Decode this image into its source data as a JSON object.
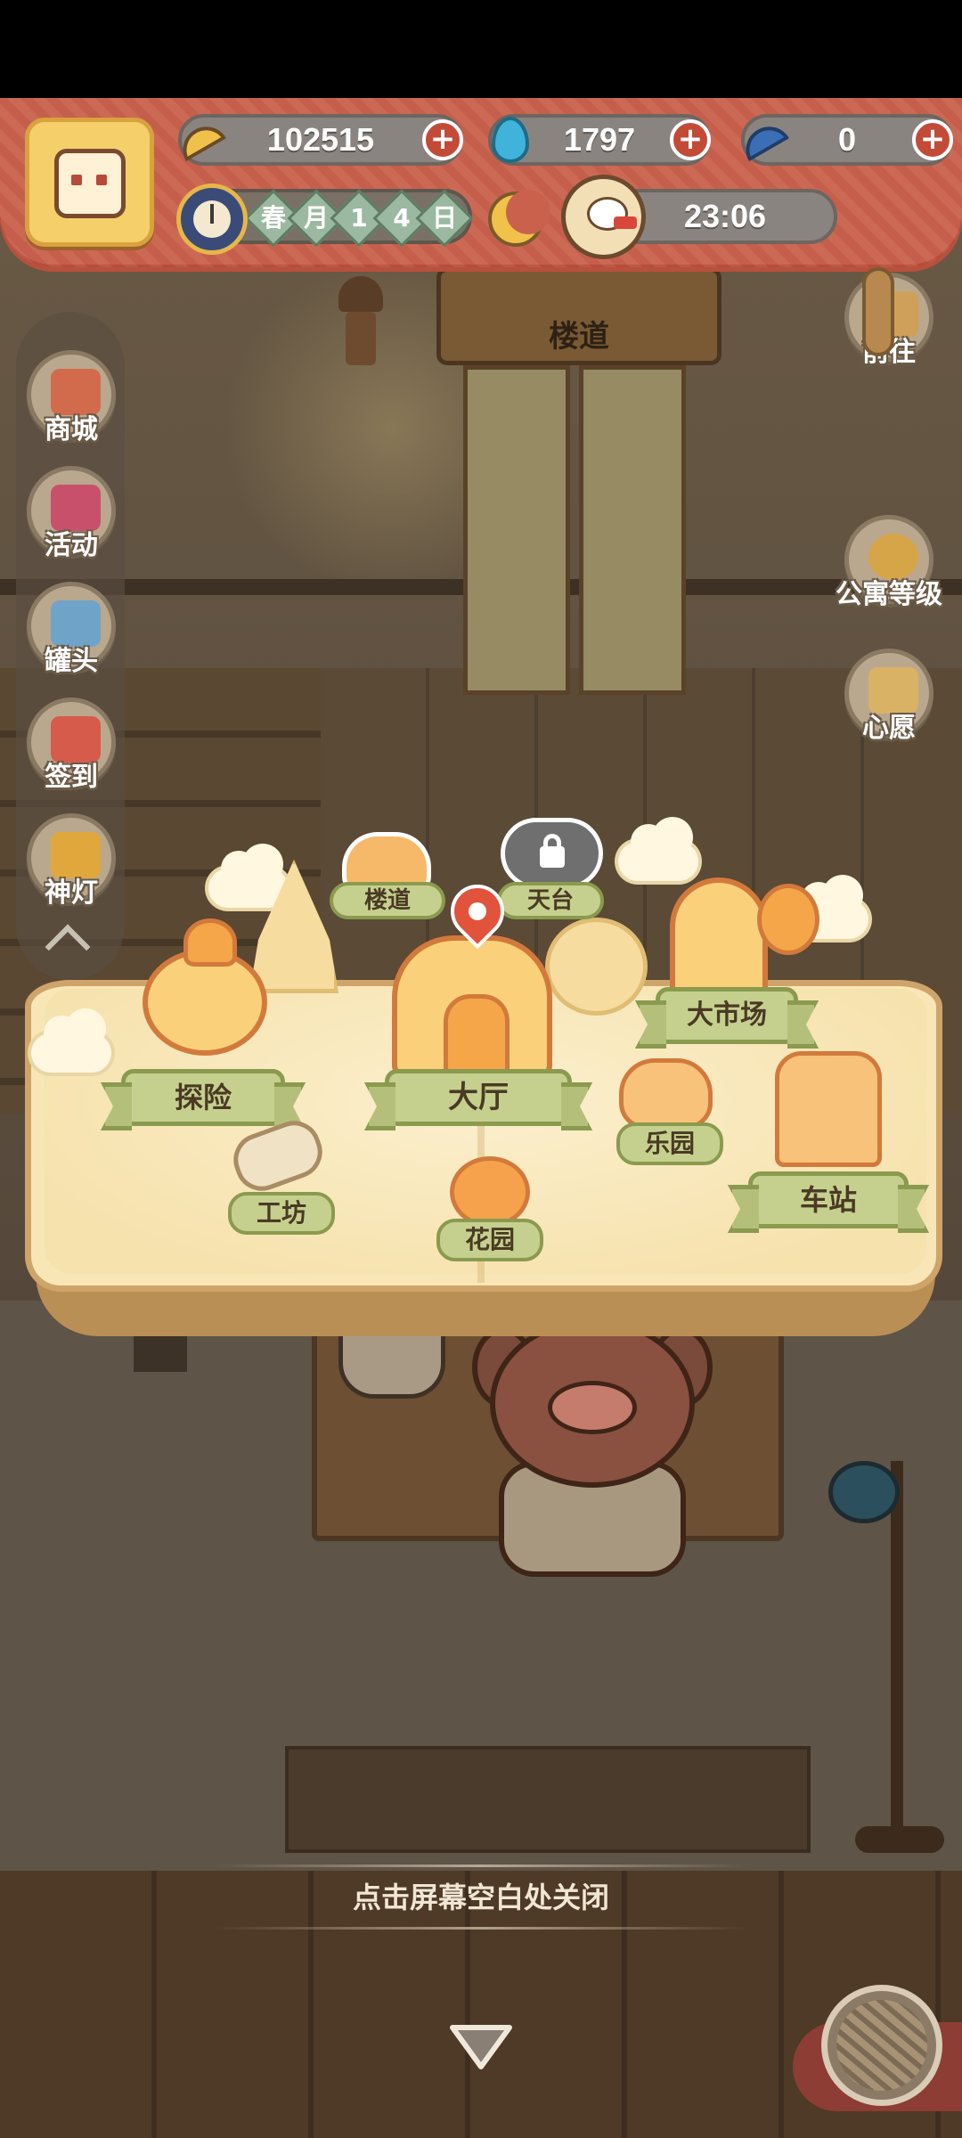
{
  "currencies": {
    "bananas": "102515",
    "flames": "1797",
    "blue_bananas": "0"
  },
  "date": {
    "season": "春",
    "month_label": "月",
    "day_digit1": "1",
    "day_digit2": "4",
    "day_label": "日"
  },
  "time": "23:06",
  "left_menu": [
    {
      "label": "商城",
      "icon": "shop-icon",
      "color": "#d26b4b"
    },
    {
      "label": "活动",
      "icon": "gift-icon",
      "color": "#c9506b"
    },
    {
      "label": "罐头",
      "icon": "can-icon",
      "color": "#6fa4c8"
    },
    {
      "label": "签到",
      "icon": "signin-icon",
      "color": "#d75b4a"
    },
    {
      "label": "神灯",
      "icon": "lamp-icon",
      "color": "#e0a83c"
    }
  ],
  "right_menu": [
    {
      "label": "前往",
      "icon": "map-pin-icon"
    },
    {
      "label": "公寓等级",
      "icon": "apartment-badge-icon"
    },
    {
      "label": "心愿",
      "icon": "wish-book-icon"
    }
  ],
  "scene": {
    "elevator_sign": "楼道"
  },
  "map": {
    "locations": {
      "stairs": "楼道",
      "rooftop": "天台",
      "market": "大市场",
      "explore": "探险",
      "hall": "大厅",
      "park": "乐园",
      "station": "车站",
      "workshop": "工坊",
      "garden": "花园"
    }
  },
  "close_hint": "点击屏幕空白处关闭",
  "colors": {
    "topbar": "#c9614c",
    "ribbon": "#c6d08e",
    "pin": "#e2533c"
  }
}
